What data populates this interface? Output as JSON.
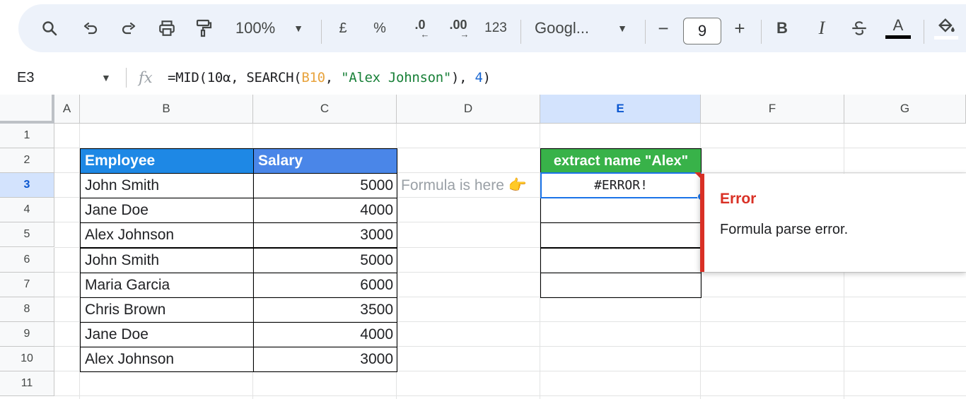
{
  "toolbar": {
    "zoom": "100%",
    "currency": "£",
    "percent": "%",
    "decrease_decimals": ".0",
    "increase_decimals": ".00",
    "number_format": "123",
    "font": "Googl...",
    "font_size": "9",
    "minus": "−",
    "plus": "+",
    "bold": "B",
    "italic": "I",
    "text_color": "A"
  },
  "formula_bar": {
    "cell_ref": "E3",
    "fx": "fx",
    "formula_prefix": "=MID(10α, SEARCH(",
    "formula_ref": "B10",
    "formula_sep1": ", ",
    "formula_str": "\"Alex Johnson\"",
    "formula_sep2": "), ",
    "formula_num": "4",
    "formula_suffix": ")"
  },
  "columns": [
    "A",
    "B",
    "C",
    "D",
    "E",
    "F",
    "G"
  ],
  "rows": [
    "1",
    "2",
    "3",
    "4",
    "5",
    "6",
    "7",
    "8",
    "9",
    "10",
    "11"
  ],
  "table": {
    "header_employee": "Employee",
    "header_salary": "Salary",
    "records": [
      {
        "name": "John Smith",
        "salary": "5000"
      },
      {
        "name": "Jane Doe",
        "salary": "4000"
      },
      {
        "name": "Alex Johnson",
        "salary": "3000"
      },
      {
        "name": "John Smith",
        "salary": "5000"
      },
      {
        "name": "Maria Garcia",
        "salary": "6000"
      },
      {
        "name": "Chris Brown",
        "salary": "3500"
      },
      {
        "name": "Jane Doe",
        "salary": "4000"
      },
      {
        "name": "Alex Johnson",
        "salary": "3000"
      }
    ]
  },
  "note": "Formula is here 👉",
  "extract": {
    "header": "extract name \"Alex\"",
    "result": "#ERROR!"
  },
  "error_popup": {
    "title": "Error",
    "message": "Formula parse error."
  },
  "colors": {
    "employee_header": "#1e88e5",
    "salary_header": "#4a86e8",
    "extract_header": "#38b249",
    "error": "#d93025",
    "selection": "#1a73e8"
  }
}
